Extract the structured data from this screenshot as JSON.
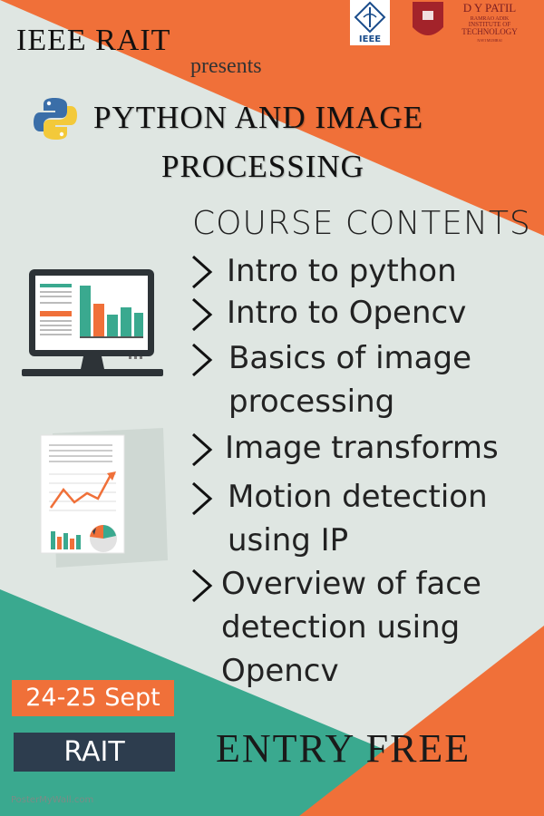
{
  "header": {
    "organizer": "IEEE  RAIT",
    "presents": "presents",
    "title_line1": "PYTHON  AND  IMAGE",
    "title_line2": "PROCESSING"
  },
  "logos": {
    "ieee_text": "IEEE",
    "dypatil_name": "D Y PATIL",
    "dypatil_line2": "RAMRAO ADIK",
    "dypatil_line3": "INSTITUTE OF",
    "dypatil_line4": "TECHNOLOGY",
    "dypatil_line5": "NAVI MUMBAI"
  },
  "course": {
    "heading": "COURSE CONTENTS",
    "items": [
      {
        "lines": [
          "Intro to python"
        ]
      },
      {
        "lines": [
          "Intro to Opencv"
        ]
      },
      {
        "lines": [
          "Basics of image",
          "processing"
        ]
      },
      {
        "lines": [
          "Image transforms"
        ]
      },
      {
        "lines": [
          "Motion detection",
          "using IP"
        ]
      },
      {
        "lines": [
          "Overview of face",
          "detection using",
          "Opencv"
        ]
      }
    ]
  },
  "footer": {
    "date": "24-25 Sept",
    "venue": "RAIT",
    "entry": "ENTRY  FREE",
    "credit": "PosterMyWall.com"
  },
  "colors": {
    "orange": "#f07039",
    "teal": "#3aa98f",
    "background": "#dfe6e2",
    "navy": "#2d3d4e"
  }
}
